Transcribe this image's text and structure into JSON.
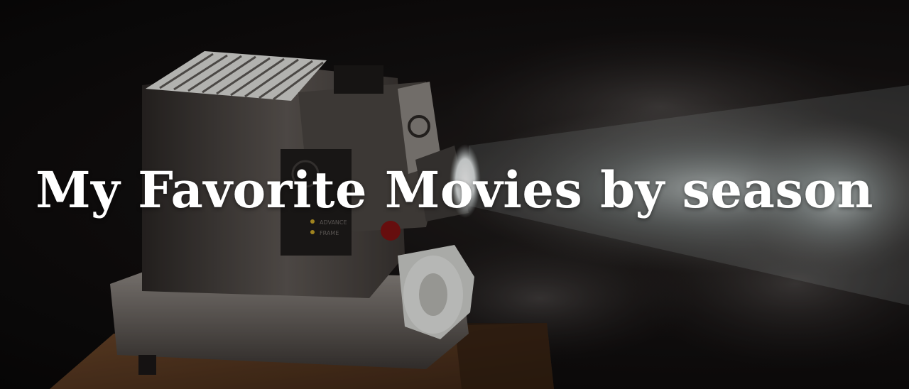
{
  "hero": {
    "title": "My Favorite Movies by season",
    "background_image": "vintage film projector emitting a beam of light through smoke",
    "projector_labels": {
      "advance": "ADVANCE",
      "frame": "FRAME"
    }
  },
  "colors": {
    "title_text": "#ffffff",
    "background": "#0b0909",
    "beam": "#c9d4d4",
    "wood_table": "#5a3a24"
  }
}
